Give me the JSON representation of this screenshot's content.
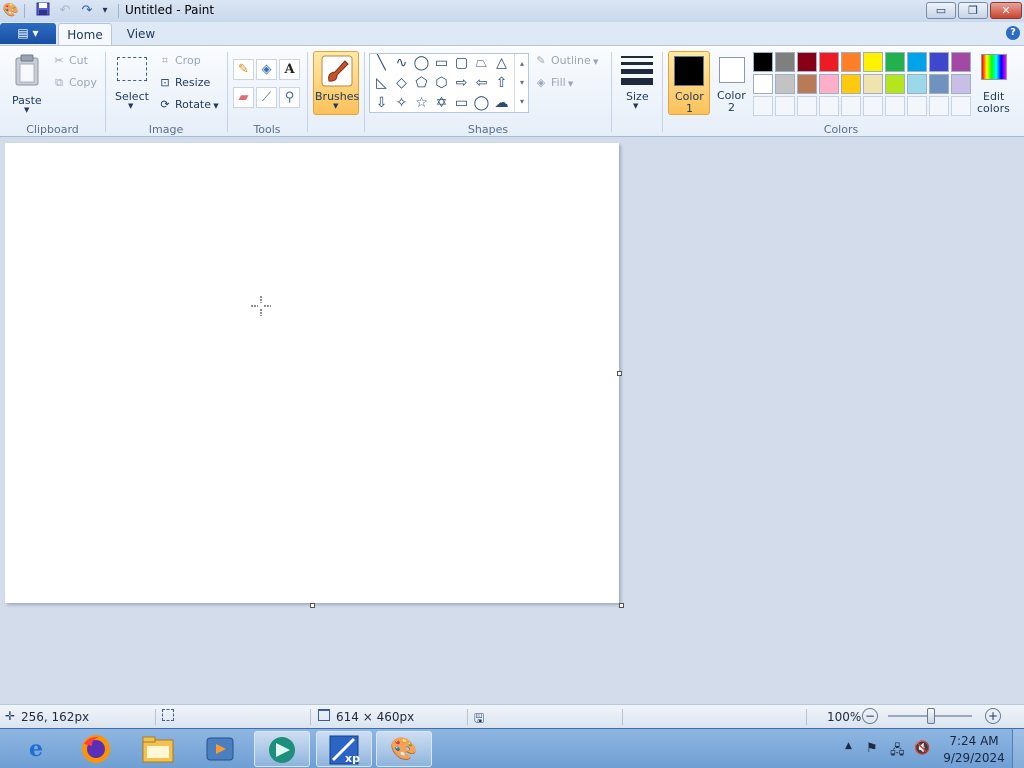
{
  "window": {
    "title": "Untitled - Paint",
    "controls": {
      "minimize": "▭",
      "maximize": "❐",
      "close": "✕"
    }
  },
  "ribbon": {
    "tabs": {
      "file": "▤ ▾",
      "home": "Home",
      "view": "View"
    },
    "clipboard": {
      "paste": "Paste",
      "cut": "Cut",
      "copy": "Copy",
      "group": "Clipboard"
    },
    "image": {
      "select": "Select",
      "crop": "Crop",
      "resize": "Resize",
      "rotate": "Rotate",
      "group": "Image"
    },
    "tools": {
      "group": "Tools"
    },
    "brushes": {
      "label": "Brushes"
    },
    "shapes": {
      "outline": "Outline",
      "fill": "Fill",
      "group": "Shapes"
    },
    "size": {
      "label": "Size"
    },
    "colors": {
      "color1_line1": "Color",
      "color1_line2": "1",
      "color2_line1": "Color",
      "color2_line2": "2",
      "edit_line1": "Edit",
      "edit_line2": "colors",
      "group": "Colors",
      "color1_value": "#000000",
      "color2_value": "#ffffff",
      "palette_row1": [
        "#000000",
        "#7f7f7f",
        "#880015",
        "#ed1c24",
        "#ff7f27",
        "#fff200",
        "#22b14c",
        "#00a2e8",
        "#3f48cc",
        "#a349a4"
      ],
      "palette_row2": [
        "#ffffff",
        "#c3c3c3",
        "#b97a57",
        "#ffaec9",
        "#ffc90e",
        "#efe4b0",
        "#b5e61d",
        "#99d9ea",
        "#7092be",
        "#c8bfe7"
      ]
    }
  },
  "status": {
    "cursor_pos": "256, 162px",
    "canvas_size": "614 × 460px",
    "zoom": "100%"
  },
  "taskbar": {
    "time": "7:24 AM",
    "date": "9/29/2024"
  }
}
